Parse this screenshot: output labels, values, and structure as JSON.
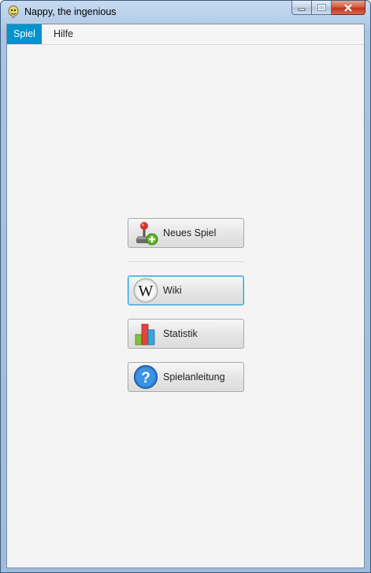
{
  "window": {
    "title": "Nappy, the ingenious"
  },
  "menu": {
    "items": [
      {
        "label": "Spiel"
      },
      {
        "label": "Hilfe"
      }
    ]
  },
  "buttons": [
    {
      "label": "Neues Spiel",
      "icon": "joystick-add-icon"
    },
    {
      "label": "Wiki",
      "icon": "wikipedia-icon"
    },
    {
      "label": "Statistik",
      "icon": "bar-chart-icon"
    },
    {
      "label": "Spielanleitung",
      "icon": "help-icon"
    }
  ],
  "colors": {
    "menu_active": "#0093cd",
    "focus_border": "#2c9dd8"
  }
}
